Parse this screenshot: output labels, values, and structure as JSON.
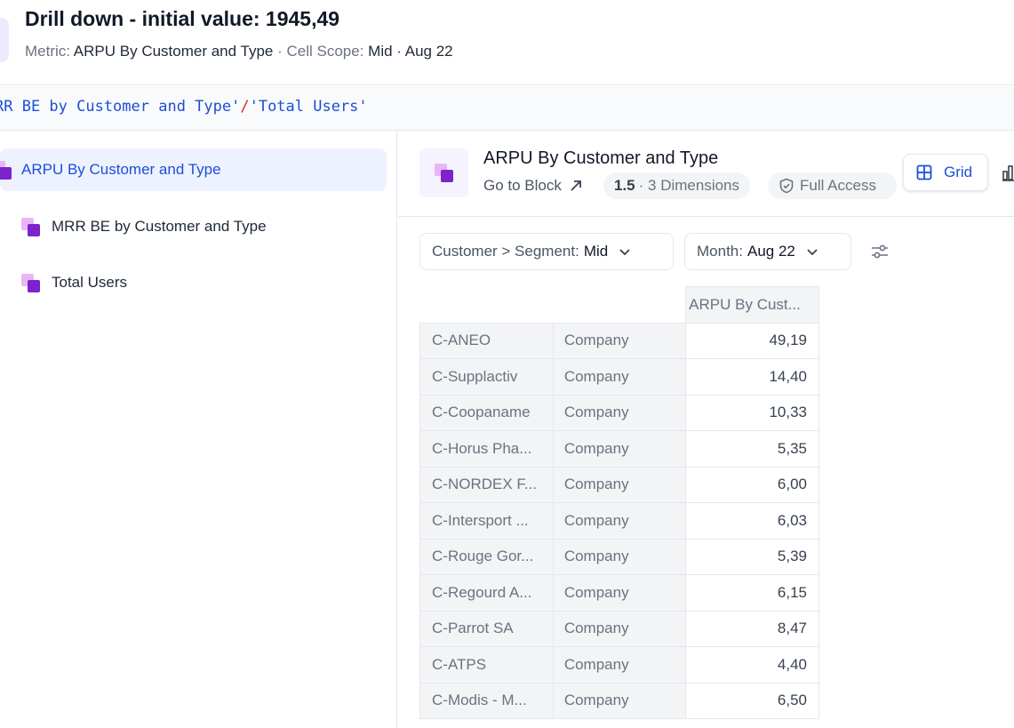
{
  "header": {
    "title": "Drill down - initial value: 1945,49",
    "metric_label": "Metric:",
    "metric_value": "ARPU By Customer and Type",
    "separator": "·",
    "scope_label": "Cell Scope:",
    "scope_value": "Mid · Aug 22"
  },
  "formula": {
    "part1": "RR BE by Customer and Type'",
    "operator": "/",
    "part2": "'Total Users'"
  },
  "sidebar": {
    "items": [
      {
        "label": "ARPU By Customer and Type",
        "selected": true
      },
      {
        "label": "MRR BE by Customer and Type"
      },
      {
        "label": "Total Users"
      }
    ]
  },
  "block": {
    "title": "ARPU By Customer and Type",
    "goto_label": "Go to Block",
    "version": "1.5",
    "dimensions": "· 3 Dimensions",
    "access": "Full Access",
    "grid_label": "Grid"
  },
  "filters": {
    "segment_label": "Customer > Segment:",
    "segment_value": "Mid",
    "month_label": "Month:",
    "month_value": "Aug 22"
  },
  "table": {
    "column_header": "ARPU By Cust...",
    "rows": [
      {
        "customer": "C-ANEO",
        "type": "Company",
        "value": "49,19"
      },
      {
        "customer": "C-Supplactiv",
        "type": "Company",
        "value": "14,40"
      },
      {
        "customer": "C-Coopaname",
        "type": "Company",
        "value": "10,33"
      },
      {
        "customer": "C-Horus Pha...",
        "type": "Company",
        "value": "5,35"
      },
      {
        "customer": "C-NORDEX F...",
        "type": "Company",
        "value": "6,00"
      },
      {
        "customer": "C-Intersport ...",
        "type": "Company",
        "value": "6,03"
      },
      {
        "customer": "C-Rouge Gor...",
        "type": "Company",
        "value": "5,39"
      },
      {
        "customer": "C-Regourd A...",
        "type": "Company",
        "value": "6,15"
      },
      {
        "customer": "C-Parrot SA",
        "type": "Company",
        "value": "8,47"
      },
      {
        "customer": "C-ATPS",
        "type": "Company",
        "value": "4,40"
      },
      {
        "customer": "C-Modis - M...",
        "type": "Company",
        "value": "6,50"
      }
    ]
  },
  "colors": {
    "accent": "#1d4ed8",
    "selected_bg": "#eef2ff",
    "block_icon_primary": "#7e22ce",
    "block_icon_secondary": "#e9b6f5"
  }
}
